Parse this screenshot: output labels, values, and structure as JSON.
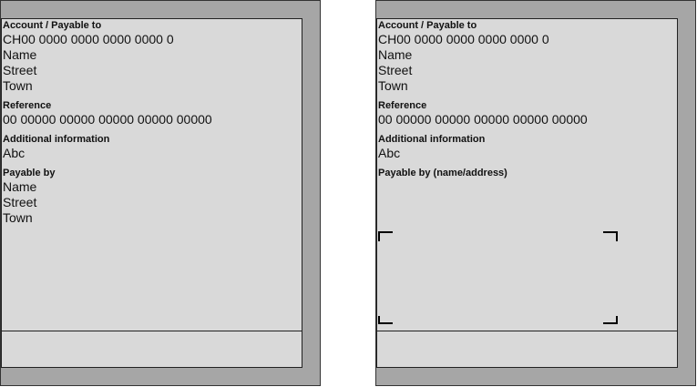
{
  "left_slip": {
    "account_label": "Account / Payable to",
    "account_number": "CH00 0000 0000 0000 0000 0",
    "payee_name": "Name",
    "payee_street": "Street",
    "payee_town": "Town",
    "reference_label": "Reference",
    "reference_number": "00 00000 00000 00000 00000 00000",
    "additional_label": "Additional information",
    "additional_value": "Abc",
    "payable_by_label": "Payable by",
    "payer_name": "Name",
    "payer_street": "Street",
    "payer_town": "Town"
  },
  "right_slip": {
    "account_label": "Account / Payable to",
    "account_number": "CH00 0000 0000 0000 0000 0",
    "payee_name": "Name",
    "payee_street": "Street",
    "payee_town": "Town",
    "reference_label": "Reference",
    "reference_number": "00 00000 00000 00000 00000 00000",
    "additional_label": "Additional information",
    "additional_value": "Abc",
    "payable_by_label": "Payable by (name/address)"
  },
  "colors": {
    "frame": "#a6a6a6",
    "panel": "#d9d9d9",
    "border": "#222222"
  }
}
